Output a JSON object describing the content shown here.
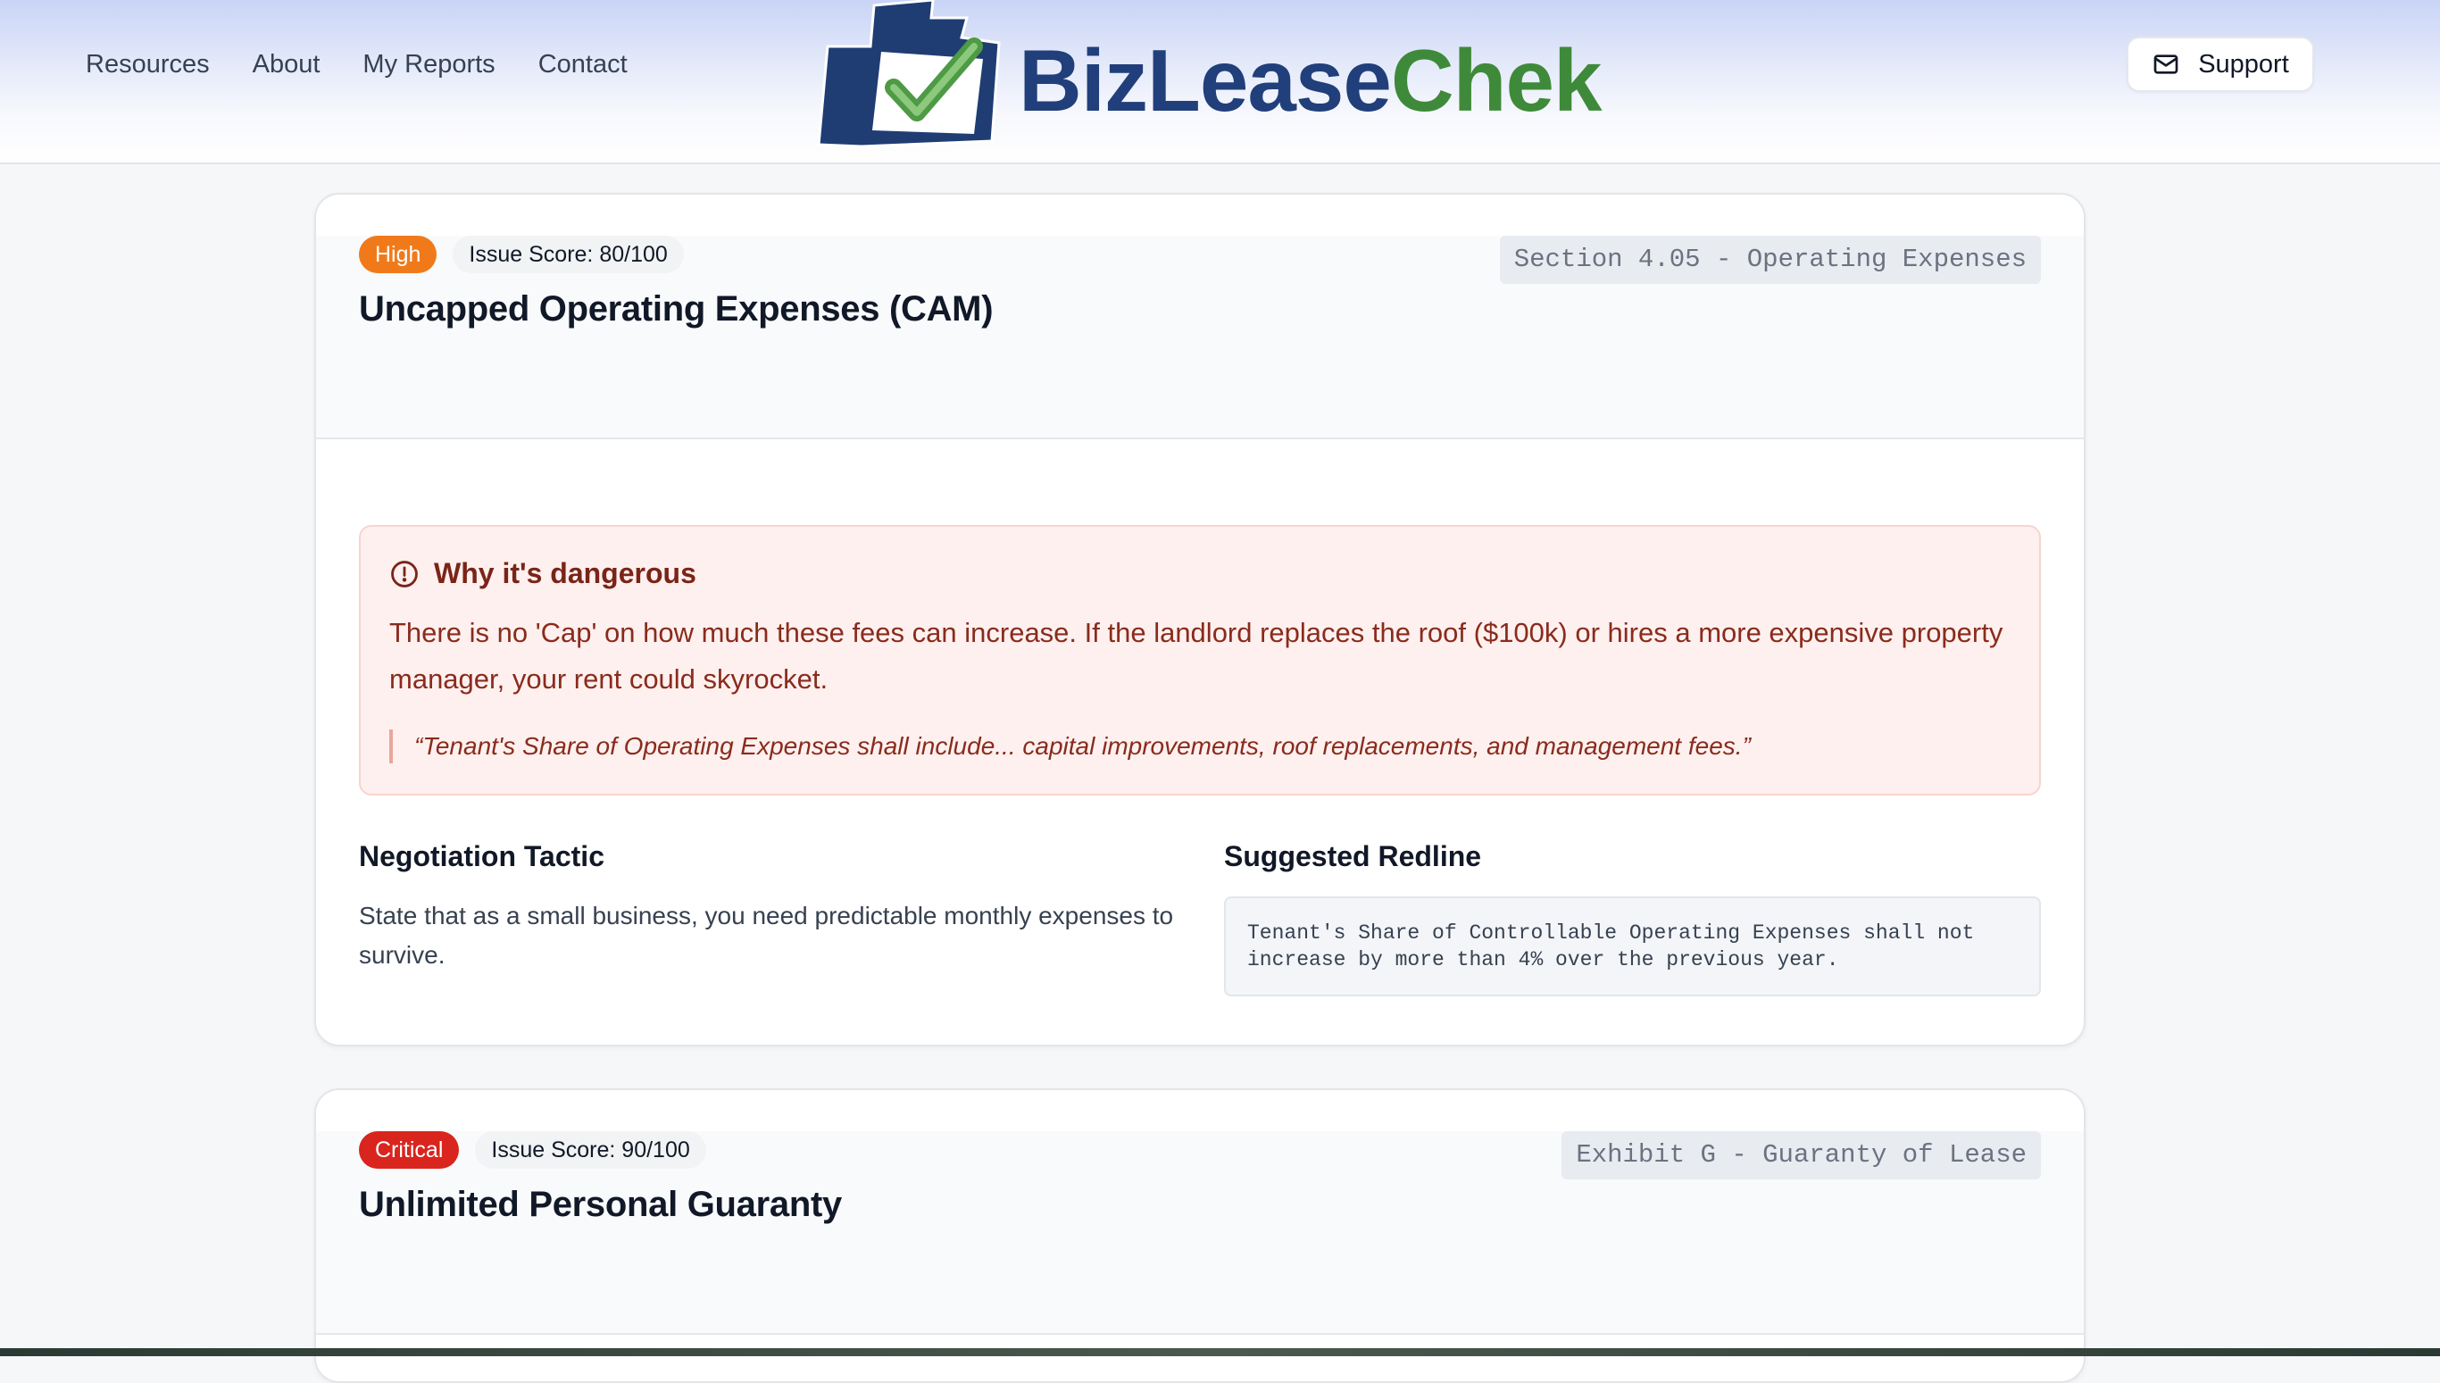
{
  "nav": {
    "items": [
      "Resources",
      "About",
      "My Reports",
      "Contact"
    ]
  },
  "logo": {
    "part1": "BizLease",
    "part2": "Chek",
    "colors": {
      "navy": "#213f7a",
      "green": "#3f8a3a"
    }
  },
  "support": {
    "label": "Support",
    "icon": "mail-icon"
  },
  "issues": [
    {
      "severity": "High",
      "severity_color": "#f07a1a",
      "score": "Issue Score: 80/100",
      "title": "Uncapped Operating Expenses (CAM)",
      "section": "Section 4.05 - Operating Expenses",
      "danger_title": "Why it's dangerous",
      "danger_text": "There is no 'Cap' on how much these fees can increase. If the landlord replaces the roof ($100k) or hires a more expensive property manager, your rent could skyrocket.",
      "quote": "“Tenant's Share of Operating Expenses shall include... capital improvements, roof replacements, and management fees.”",
      "tactic_title": "Negotiation Tactic",
      "tactic_text": "State that as a small business, you need predictable monthly expenses to survive.",
      "redline_title": "Suggested Redline",
      "redline_text": "Tenant's Share of Controllable Operating Expenses shall not increase by more than 4% over the previous year."
    },
    {
      "severity": "Critical",
      "severity_color": "#d9251d",
      "score": "Issue Score: 90/100",
      "title": "Unlimited Personal Guaranty",
      "section": "Exhibit G - Guaranty of Lease"
    }
  ]
}
